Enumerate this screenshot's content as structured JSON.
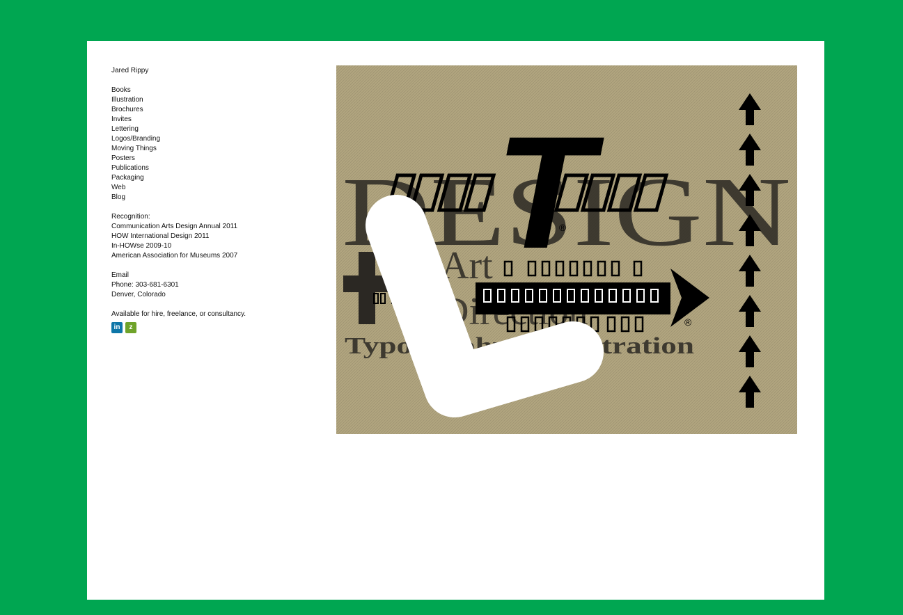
{
  "site": {
    "name": "Jared Rippy"
  },
  "nav": [
    {
      "label": "Books"
    },
    {
      "label": "Illustration"
    },
    {
      "label": "Brochures"
    },
    {
      "label": "Invites"
    },
    {
      "label": "Lettering"
    },
    {
      "label": "Logos/Branding"
    },
    {
      "label": "Moving Things"
    },
    {
      "label": "Posters"
    },
    {
      "label": "Publications"
    },
    {
      "label": "Packaging"
    },
    {
      "label": "Web"
    },
    {
      "label": "Blog"
    }
  ],
  "recognition": {
    "heading": "Recognition:",
    "items": [
      "Communication Arts Design Annual 2011",
      "HOW International Design 2011",
      "In-HOWse 2009-10",
      "American Association for Museums 2007"
    ]
  },
  "contact": {
    "email_label": "Email",
    "phone": "Phone: 303-681-6301",
    "location": "Denver, Colorado"
  },
  "availability": "Available for hire, freelance, or consultancy.",
  "social": [
    {
      "icon": "linkedin-icon",
      "glyph": "in",
      "color": "#0e76a8"
    },
    {
      "icon": "zerply-icon",
      "glyph": "z",
      "color": "#6fa32a"
    }
  ],
  "artwork": {
    "background": "#b1a57f",
    "big_word": "DESIGN",
    "art": "Art",
    "direction": "Direction",
    "typography_line": "Typography + Illustration",
    "reg_mark": "®",
    "logo_letter": "T"
  },
  "colors": {
    "frame": "#00a651",
    "page": "#ffffff",
    "text": "#111111"
  }
}
